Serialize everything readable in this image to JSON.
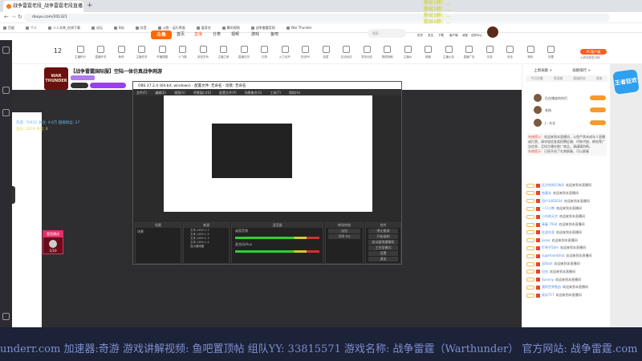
{
  "browser": {
    "tab_title": "战争雷霆老段_战争雷霆老段直播",
    "url": "douyu.com/201321",
    "bookmarks": [
      "百度",
      "个人",
      "人人文库_在线下载",
      "论坛",
      "B站",
      "抖音",
      "斗鱼 - 运行界面",
      "爱奇艺",
      "腾讯视频",
      "战争雷霆官网",
      "War Thunder"
    ]
  },
  "overlay": [
    "粉丝1群：...",
    "粉丝2群：...",
    "粉丝3群：...",
    "粉丝4群：..."
  ],
  "nav": {
    "logo": "斗鱼",
    "items": [
      "首页",
      "直播",
      "分类",
      "视频",
      "游戏",
      "鱼吧"
    ],
    "search_placeholder": "搜索",
    "right_icons": [
      "历史",
      "关注",
      "下载",
      "客户端",
      "消息",
      "创作中心"
    ]
  },
  "toolbar": {
    "follow_count": "12",
    "items": [
      "主播积分",
      "直播开关",
      "鱼吧",
      "主播任务",
      "开播提醒",
      "小飞碟",
      "亲密关系",
      "主播之家",
      "直播日历",
      "礼物",
      "火力全开",
      "在线PK",
      "连麦",
      "互动玩法",
      "发布动态",
      "视频投稿",
      "主播AI",
      "超管",
      "主播公告",
      "直播广告",
      "手游",
      "安全",
      "精彩",
      "设置"
    ],
    "pc_button": "PC客户端",
    "pc_sub": "大屏观看更流畅"
  },
  "room": {
    "avatar_text": "WAR THUNDER",
    "title": "【战争雷霆国际服】空陆一体仿真战争网游"
  },
  "stats": {
    "line1": "热度: 70932    关注: 4.6万    超级粉丝: 27",
    "line2": "鱼丸: 2819                              热度: 0"
  },
  "obs": {
    "title": "OBS 27.2.4 (64-bit, windows) - 配置文件: 无命名 - 场景: 无命名",
    "menu": [
      "文件(F)",
      "编辑(E)",
      "视图(V)",
      "停靠窗口(D)",
      "配置文件(P)",
      "场景集合(S)",
      "工具(T)",
      "帮助(H)"
    ],
    "docks": {
      "scenes": "场景",
      "sources": "来源",
      "mixer": "混音器",
      "transitions": "转场特效",
      "controls": "控件"
    },
    "scene_items": [
      "场景"
    ],
    "source_items": [
      "文本 (GDI+) 1",
      "文本 (GDI+) 2",
      "文本 (GDI+) 3",
      "文本 (GDI+) 4",
      "显示器采集"
    ],
    "mixer_items": [
      "桌面音频",
      "麦克风/Aux"
    ],
    "transition": "淡出",
    "duration": "300 ms",
    "controls": [
      "停止推流",
      "开始录制",
      "启动虚拟摄像机",
      "工作室模式",
      "设置",
      "退出"
    ]
  },
  "gift": {
    "label": "看直播送",
    "count": "1/10"
  },
  "right": {
    "tabs": [
      "今日贡献",
      "周贡献",
      "超级粉丝",
      "贵族"
    ],
    "links": [
      "上周贡献 >",
      "贡献排行 >"
    ],
    "rank": [
      {
        "name": "仍在播放的你们"
      },
      {
        "name": "老杨"
      },
      {
        "name": "J・东北"
      }
    ],
    "notice_label": "系统提示：",
    "notice": "欢迎来到本直播间，斗鱼严禁未成年人直播或打赏，请勿轻信各类招聘征婚、代练代抽、刷钻等广告信息，且如主播在推广商品，请谨慎判断。",
    "notice2_label": "系统提示：",
    "notice2": "已经开启了礼物屏蔽，可以屏蔽",
    "chat": [
      {
        "u": "远方的知识海洋",
        "t": "欢迎来到本直播间"
      },
      {
        "u": "哈基米",
        "t": "欢迎来到本直播间"
      },
      {
        "u": "用户1462034",
        "t": "欢迎来到本直播间"
      },
      {
        "u": "一只小熊",
        "t": "欢迎来到本直播间"
      },
      {
        "u": "小鸟的天空",
        "t": "欢迎来到本直播间"
      },
      {
        "u": "青春 7934",
        "t": "欢迎来到本直播间"
      },
      {
        "u": "在战车里",
        "t": "欢迎来到本直播间"
      },
      {
        "u": "jonas",
        "t": "欢迎来到本直播间"
      },
      {
        "u": "叮咚不50m",
        "t": "欢迎来到本直播间"
      },
      {
        "u": "superlandshot",
        "t": "欢迎来到本直播间"
      },
      {
        "u": "志flash",
        "t": "欢迎来到本直播间"
      },
      {
        "u": "坦克",
        "t": "欢迎来到本直播间"
      },
      {
        "u": "Sunnny",
        "t": "欢迎来到本直播间"
      },
      {
        "u": "我的世界铁血",
        "t": "欢迎来到本直播间"
      },
      {
        "u": "疾风717",
        "t": "欢迎来到本直播间"
      }
    ]
  },
  "ad": {
    "label": "王者狂欢"
  },
  "ticker": "underr.com  加速器:奇游  游戏讲解视频: 鱼吧置顶帖  组队YY: 33815571  游戏名称: 战争雷霆（Warthunder） 官方网站: 战争雷霆.com"
}
